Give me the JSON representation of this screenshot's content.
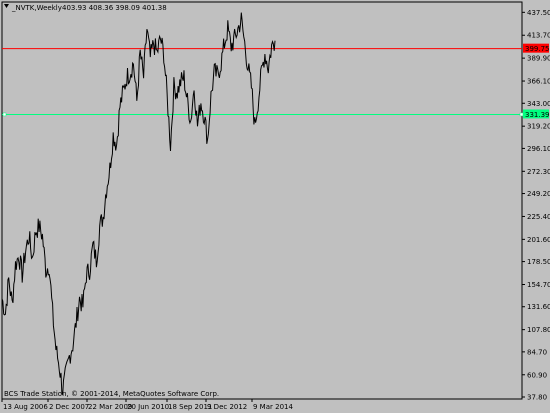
{
  "header": {
    "symbol": "_NVTK,Weekly",
    "ohlc": "403.93 408.36 398.09 401.38"
  },
  "footer": {
    "copyright": "BCS Trade Station, © 2001-2014, MetaQuotes Software Corp."
  },
  "colors": {
    "background": "#c0c0c0",
    "series": "#000000",
    "red_line": "#ff0000",
    "green_line": "#00ff7f",
    "axis": "#000000"
  },
  "chart_data": {
    "type": "line",
    "title": "_NVTK,Weekly",
    "ylim": [
      37.8,
      436.8
    ],
    "y_ticks": [
      437.5,
      413.7,
      389.9,
      366.1,
      343.0,
      319.2,
      296.1,
      272.3,
      249.2,
      225.4,
      201.6,
      178.5,
      154.7,
      131.6,
      107.8,
      84.7,
      60.9,
      37.8
    ],
    "x_ticks": [
      "13 Aug 2006",
      "2 Dec 2007",
      "22 Mar 2009",
      "20 Jun 2010",
      "18 Sep 2011",
      "9 Dec 2012",
      "9 Mar 2014"
    ],
    "levels": [
      {
        "name": "red",
        "value": 399.75,
        "label": "399.75"
      },
      {
        "name": "green",
        "value": 331.39,
        "label": "331.39"
      }
    ],
    "series": [
      {
        "points": [
          [
            "13 Aug 2006",
            140
          ],
          [
            "Oct 2006",
            125
          ],
          [
            "Dec 2006",
            160
          ],
          [
            "Feb 2007",
            135
          ],
          [
            "Apr 2007",
            175
          ],
          [
            "Jun 2007",
            185
          ],
          [
            "Aug 2007",
            165
          ],
          [
            "Oct 2007",
            190
          ],
          [
            "Dec 2007",
            205
          ],
          [
            "Jan 2008",
            182
          ],
          [
            "Mar 2008",
            210
          ],
          [
            "Apr 2008",
            215
          ],
          [
            "May 2008",
            205
          ],
          [
            "Jun 2008",
            170
          ],
          [
            "Jul 2008",
            175
          ],
          [
            "Sep 2008",
            125
          ],
          [
            "Oct 2008",
            88
          ],
          [
            "Nov 2008",
            70
          ],
          [
            "Dec 2008",
            45
          ],
          [
            "Jan 2009",
            62
          ],
          [
            "Feb 2009",
            80
          ],
          [
            "Mar 2009",
            92
          ],
          [
            "Apr 2009",
            115
          ],
          [
            "May 2009",
            140
          ],
          [
            "Jun 2009",
            132
          ],
          [
            "Aug 2009",
            165
          ],
          [
            "Sep 2009",
            170
          ],
          [
            "Oct 2009",
            195
          ],
          [
            "Nov 2009",
            180
          ],
          [
            "Dec 2009",
            215
          ],
          [
            "Jan 2010",
            225
          ],
          [
            "Feb 2010",
            255
          ],
          [
            "Mar 2010",
            275
          ],
          [
            "Apr 2010",
            310
          ],
          [
            "May 2010",
            300
          ],
          [
            "Jun 2010",
            340
          ],
          [
            "Jul 2010",
            355
          ],
          [
            "Aug 2010",
            370
          ],
          [
            "Sep 2010",
            375
          ],
          [
            "Oct 2010",
            385
          ],
          [
            "Nov 2010",
            345
          ],
          [
            "Dec 2010",
            395
          ],
          [
            "Jan 2011",
            370
          ],
          [
            "Feb 2011",
            420
          ],
          [
            "Mar 2011",
            390
          ],
          [
            "Apr 2011",
            405
          ],
          [
            "May 2011",
            395
          ],
          [
            "Jun 2011",
            410
          ],
          [
            "Jul 2011",
            395
          ],
          [
            "Aug 2011",
            350
          ],
          [
            "Sep 2011",
            300
          ],
          [
            "Oct 2011",
            360
          ],
          [
            "Nov 2011",
            355
          ],
          [
            "Dec 2011",
            365
          ],
          [
            "Jan 2012",
            370
          ],
          [
            "Feb 2012",
            345
          ],
          [
            "Mar 2012",
            325
          ],
          [
            "Apr 2012",
            360
          ],
          [
            "May 2012",
            320
          ],
          [
            "Jun 2012",
            345
          ],
          [
            "Jul 2012",
            330
          ],
          [
            "Aug 2012",
            305
          ],
          [
            "Sep 2012",
            350
          ],
          [
            "Oct 2012",
            375
          ],
          [
            "Nov 2012",
            372
          ],
          [
            "Dec 2012",
            385
          ],
          [
            "Jan 2013",
            405
          ],
          [
            "Feb 2013",
            420
          ],
          [
            "Mar 2013",
            402
          ],
          [
            "Apr 2013",
            410
          ],
          [
            "May 2013",
            420
          ],
          [
            "Jun 2013",
            430
          ],
          [
            "Jul 2013",
            405
          ],
          [
            "Aug 2013",
            380
          ],
          [
            "Sep 2013",
            360
          ],
          [
            "Oct 2013",
            320
          ],
          [
            "Nov 2013",
            345
          ],
          [
            "Dec 2013",
            375
          ],
          [
            "Jan 2014",
            395
          ],
          [
            "Feb 2014",
            380
          ],
          [
            "9 Mar 2014",
            402
          ],
          [
            "Apr 2014",
            408
          ]
        ]
      }
    ]
  }
}
